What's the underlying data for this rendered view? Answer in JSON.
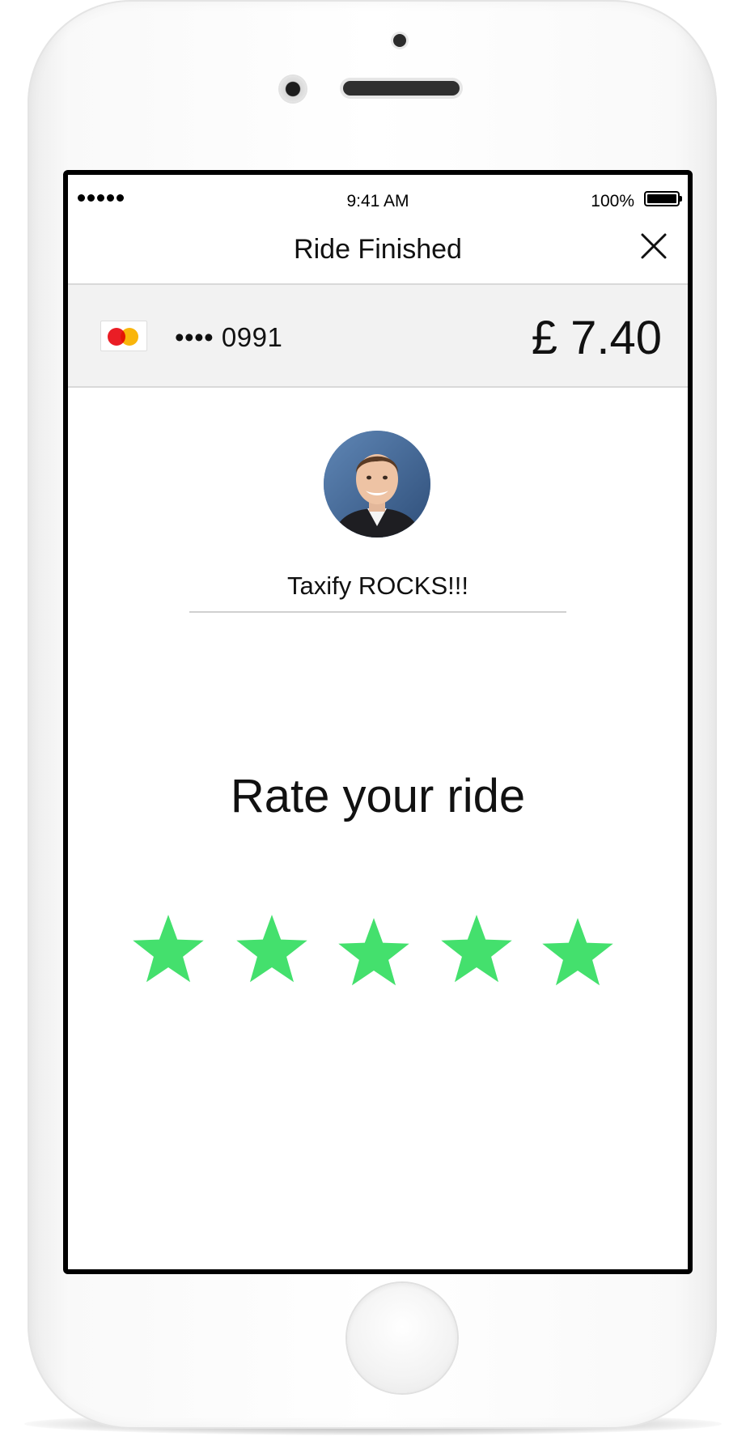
{
  "status_bar": {
    "time": "9:41 AM",
    "battery_percent": "100%"
  },
  "nav": {
    "title": "Ride Finished",
    "close_icon": "close-icon"
  },
  "payment": {
    "card_brand_icon": "mastercard-icon",
    "card_number": "•••• 0991",
    "fare": "£ 7.40"
  },
  "driver": {
    "avatar": "driver-avatar"
  },
  "comment": {
    "value": "Taxify ROCKS!!!"
  },
  "rating": {
    "title": "Rate your ride",
    "stars_selected": 5,
    "stars_total": 5,
    "star_color": "#44e06d"
  },
  "colors": {
    "accent_green": "#44e06d",
    "payment_bar_bg": "#f2f2f2"
  }
}
